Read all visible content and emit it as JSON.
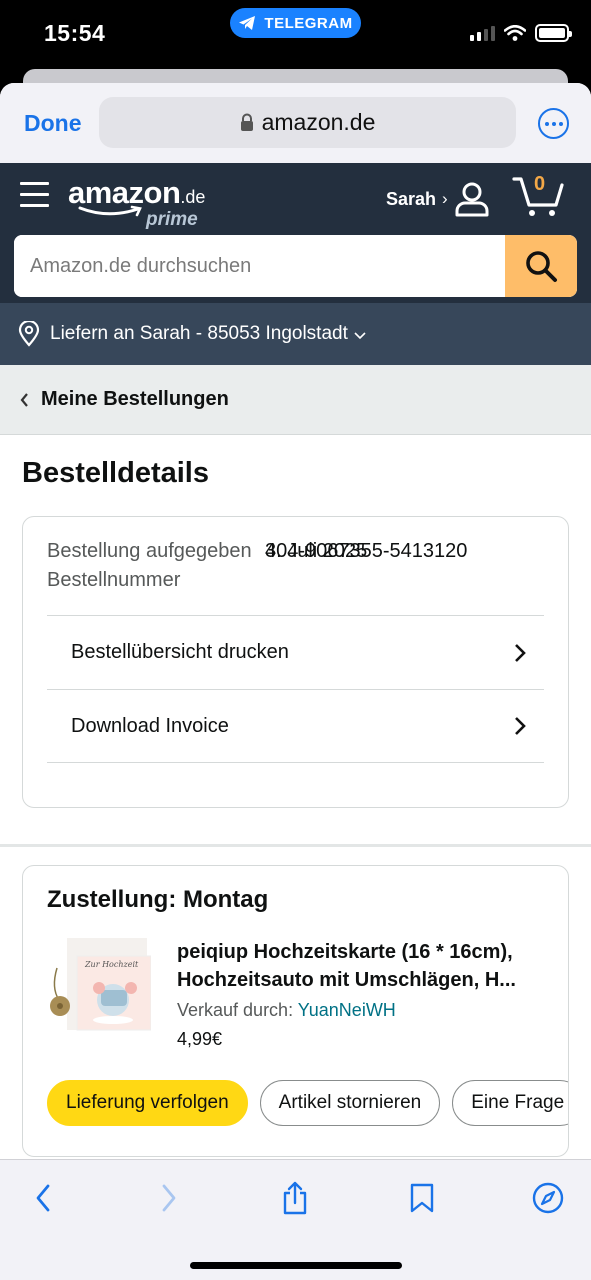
{
  "status_bar": {
    "time": "15:54",
    "app_pill": "TELEGRAM"
  },
  "browser": {
    "done_label": "Done",
    "url": "amazon.de"
  },
  "header": {
    "logo_word": "amazon",
    "logo_tld": ".de",
    "logo_prime": "prime",
    "account_name": "Sarah",
    "account_chevron": "›",
    "cart_count": "0",
    "search_placeholder": "Amazon.de durchsuchen"
  },
  "delivery": {
    "text": "Liefern an Sarah - 85053 Ingolstadt"
  },
  "breadcrumb": {
    "label": "Meine Bestellungen"
  },
  "page": {
    "title": "Bestelldetails"
  },
  "order": {
    "placed_label": "Bestellung aufgegeben",
    "placed_value": "4. Juli 2025",
    "number_label": "Bestellnummer",
    "number_value": "304-9067355-5413120",
    "links": [
      {
        "label": "Bestellübersicht drucken"
      },
      {
        "label": "Download Invoice"
      }
    ]
  },
  "shipment": {
    "title": "Zustellung: Montag",
    "item_title": "peiqiup Hochzeitskarte (16 * 16cm), Hochzeitsauto mit Umschlägen, H...",
    "seller_label": "Verkauf durch:",
    "seller_name": "YuanNeiWH",
    "price": "4,99€",
    "card_script": "Zur Hochzeit",
    "buttons": {
      "track": "Lieferung verfolgen",
      "cancel": "Artikel stornieren",
      "question": "Eine Frage"
    }
  },
  "colors": {
    "amazon_header": "#232f3e",
    "delivery_bar": "#37475a",
    "search_button": "#febd69",
    "primary_button": "#ffd814",
    "link_blue": "#007185",
    "ios_blue": "#1a73e8"
  },
  "icons": {
    "toolbar": [
      "back-icon",
      "forward-icon",
      "share-icon",
      "bookmarks-icon",
      "compass-icon"
    ]
  }
}
